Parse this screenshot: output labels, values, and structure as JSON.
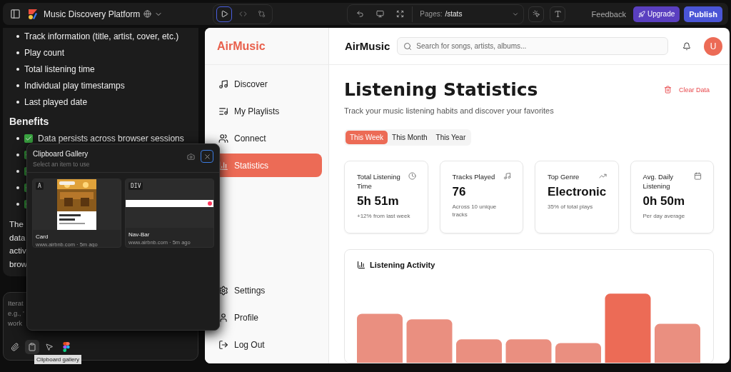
{
  "topbar": {
    "project_title": "Music Discovery Platform",
    "view_modes": [
      {
        "kind": "preview",
        "selected": true
      },
      {
        "kind": "code",
        "selected": false
      },
      {
        "kind": "compare",
        "selected": false
      }
    ],
    "pages_label": "Pages:",
    "pages_value": "/stats",
    "feedback": "Feedback",
    "upgrade": "Upgrade",
    "publish": "Publish"
  },
  "chat": {
    "bullets": [
      "Track information (title, artist, cover, etc.)",
      "Play count",
      "Total listening time",
      "Individual play timestamps",
      "Last played date"
    ],
    "benefits_heading": "Benefits",
    "benefits": [
      {
        "kind": "text",
        "text": "Data persists across browser sessions"
      },
      {
        "kind": "covered"
      },
      {
        "kind": "covered"
      },
      {
        "kind": "covered"
      },
      {
        "kind": "covered"
      }
    ],
    "paragraph_lines": [
      "The",
      "data",
      "activ",
      "brow"
    ],
    "input_hint_lines": [
      "Iterat",
      "e.g., '",
      "work"
    ],
    "input_tools": [
      {
        "kind": "attach",
        "selected": false
      },
      {
        "kind": "clipboard",
        "selected": true
      },
      {
        "kind": "select",
        "selected": false
      },
      {
        "kind": "figma",
        "selected": false
      }
    ],
    "tooltip": "Clipboard gallery"
  },
  "clipboard_gallery": {
    "title": "Clipboard Gallery",
    "subtitle": "Select an item to use",
    "items": [
      {
        "tag": "A",
        "kind": "card",
        "name": "Card",
        "source": "www.airbnb.com · 5m ago"
      },
      {
        "tag": "DIV",
        "kind": "navbar",
        "name": "Nav-Bar",
        "source": "www.airbnb.com · 5m ago"
      }
    ]
  },
  "app": {
    "logo": "AirMusic",
    "header_title": "AirMusic",
    "search_placeholder": "Search for songs, artists, albums...",
    "avatar": "U",
    "nav_top": [
      {
        "label": "Discover",
        "selected": false
      },
      {
        "label": "My Playlists",
        "selected": false
      },
      {
        "label": "Connect",
        "selected": false
      },
      {
        "label": "Statistics",
        "selected": true
      }
    ],
    "nav_bottom": [
      {
        "label": "Settings",
        "selected": false
      },
      {
        "label": "Profile",
        "selected": false
      },
      {
        "label": "Log Out",
        "selected": false
      }
    ],
    "page_title": "Listening Statistics",
    "page_subtitle": "Track your music listening habits and discover your favorites",
    "clear_data": "Clear Data",
    "period_tabs": [
      {
        "label": "This Week",
        "selected": true
      },
      {
        "label": "This Month",
        "selected": false
      },
      {
        "label": "This Year",
        "selected": false
      }
    ],
    "stat_cards": [
      {
        "title": "Total Listening Time",
        "value": "5h 51m",
        "note": "+12% from last week"
      },
      {
        "title": "Tracks Played",
        "value": "76",
        "note": "Across 10 unique tracks"
      },
      {
        "title": "Top Genre",
        "value": "Electronic",
        "note": "35% of total plays"
      },
      {
        "title": "Avg. Daily Listening",
        "value": "0h 50m",
        "note": "Per day average"
      }
    ],
    "activity_title": "Listening Activity"
  }
}
